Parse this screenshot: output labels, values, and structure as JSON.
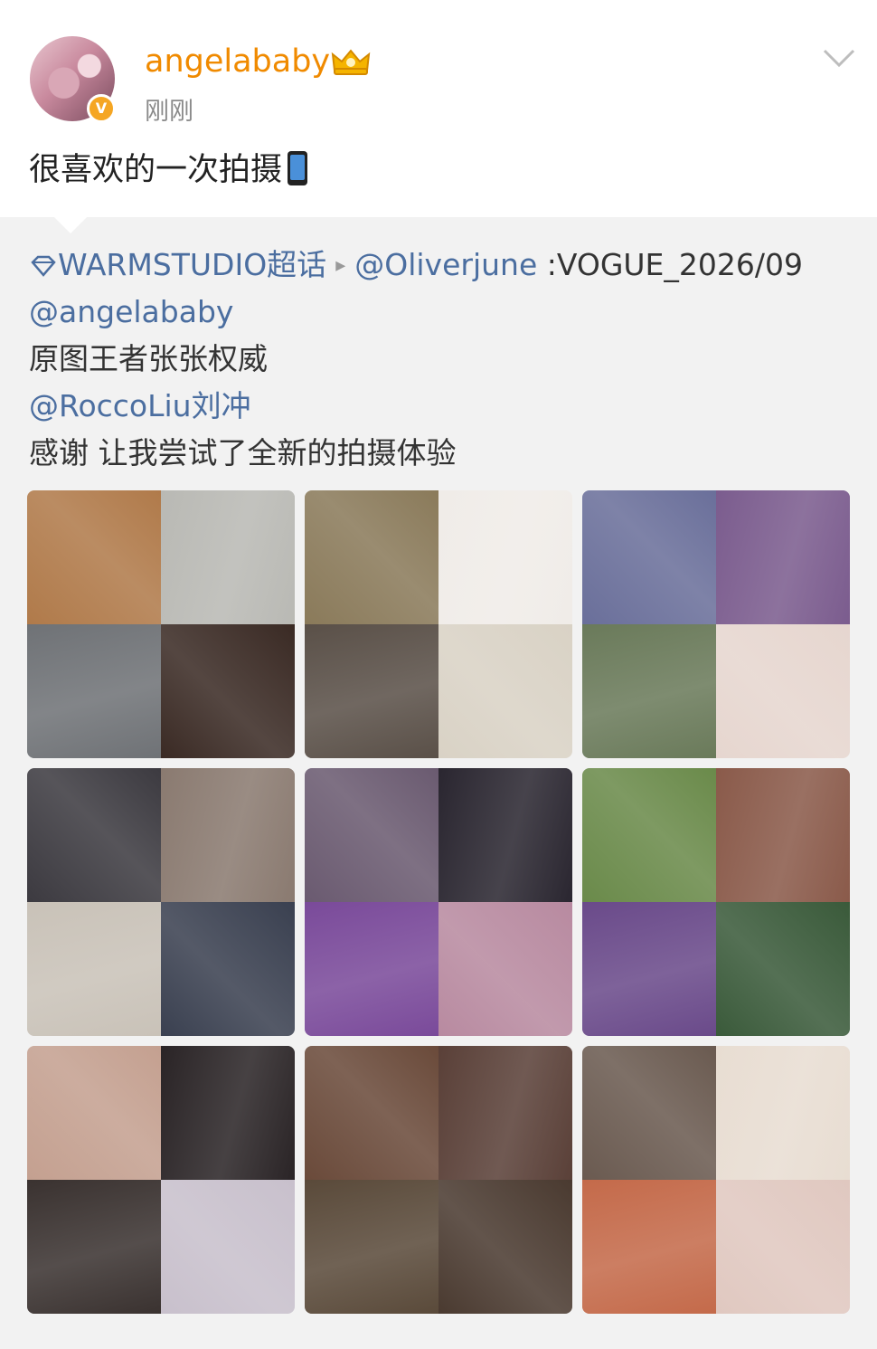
{
  "post": {
    "username": "angelababy",
    "timestamp": "刚刚",
    "text": "很喜欢的一次拍摄",
    "emoji": "mobile-phone-icon",
    "verified_badge": "V",
    "crown_icon": "crown-icon"
  },
  "repost": {
    "topic": "WARMSTUDIO超话",
    "separator": "▸",
    "author": "@Oliverjune",
    "headline": " :VOGUE_2026/09",
    "mention1": "@angelababy",
    "line1": "原图王者张张权威",
    "mention2": "@RoccoLiu刘冲",
    "line2": "感谢 让我尝试了全新的拍摄体验"
  },
  "colors": {
    "username": "#f08a00",
    "link": "#4b6ea0",
    "background": "#f2f2f2"
  },
  "gallery": {
    "image_count": 9,
    "images": [
      {
        "name": "photo-1",
        "tones": [
          "#b07a4a",
          "#b9b9b4",
          "#6f7276",
          "#3a2a24"
        ]
      },
      {
        "name": "photo-2",
        "tones": [
          "#8a7a5a",
          "#f0ece8",
          "#5a5048",
          "#d9d2c5"
        ]
      },
      {
        "name": "photo-3",
        "tones": [
          "#6a6f9a",
          "#7b5c8e",
          "#6a7a5a",
          "#e6d6cf"
        ]
      },
      {
        "name": "photo-4",
        "tones": [
          "#3c3a40",
          "#8a7a70",
          "#c9c2b8",
          "#3a4050"
        ]
      },
      {
        "name": "photo-5",
        "tones": [
          "#6a5a70",
          "#2a2630",
          "#7a4a9a",
          "#b88aa0"
        ]
      },
      {
        "name": "photo-6",
        "tones": [
          "#6a8a4a",
          "#8a5a4a",
          "#6a4a8a",
          "#3a5a3a"
        ]
      },
      {
        "name": "photo-7",
        "tones": [
          "#c4a090",
          "#2a2426",
          "#3a3230",
          "#c8c0cc"
        ]
      },
      {
        "name": "photo-8",
        "tones": [
          "#6a4a3a",
          "#5a4038",
          "#5a4a3a",
          "#4a3a30"
        ]
      },
      {
        "name": "photo-9",
        "tones": [
          "#6a5a50",
          "#e8ddd2",
          "#c46a4a",
          "#e0c8c0"
        ]
      }
    ]
  }
}
